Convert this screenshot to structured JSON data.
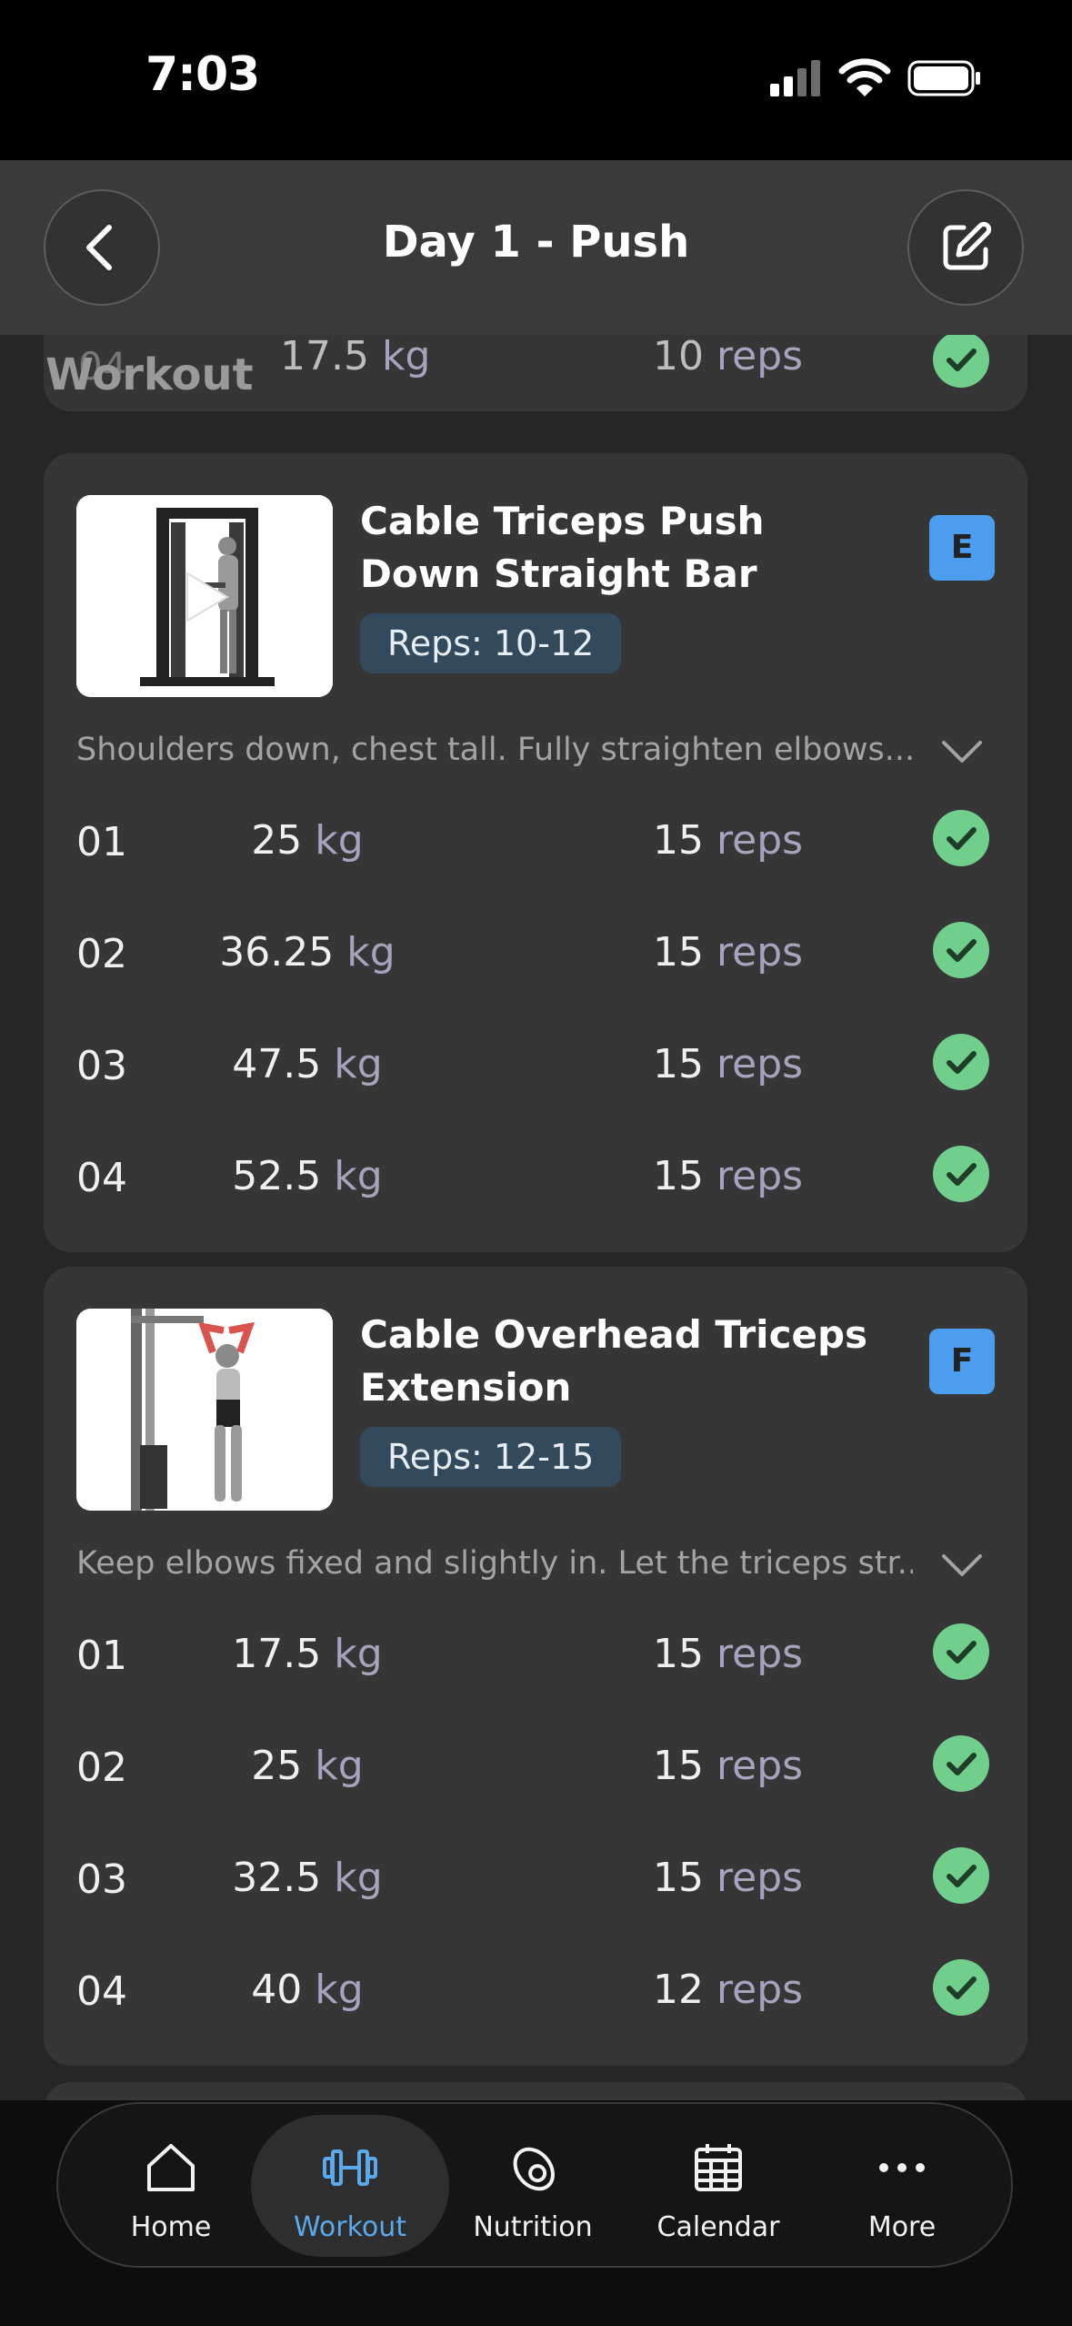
{
  "status": {
    "time": "7:03"
  },
  "header": {
    "title": "Day 1 - Push"
  },
  "overlay_label": "Workout",
  "previous_set": {
    "number": "04",
    "weight": "17.5",
    "unit_kg": "kg",
    "reps": "10",
    "unit_reps": "reps"
  },
  "exercises": [
    {
      "title": "Cable Triceps Push Down Straight Bar",
      "reps_target": "Reps: 10-12",
      "badge": "E",
      "note": "Shoulders down, chest tall. Fully straighten elbows...",
      "sets": [
        {
          "number": "01",
          "weight": "25",
          "reps": "15"
        },
        {
          "number": "02",
          "weight": "36.25",
          "reps": "15"
        },
        {
          "number": "03",
          "weight": "47.5",
          "reps": "15"
        },
        {
          "number": "04",
          "weight": "52.5",
          "reps": "15"
        }
      ]
    },
    {
      "title": "Cable Overhead Triceps Extension",
      "reps_target": "Reps: 12-15",
      "badge": "F",
      "note": "Keep elbows fixed and slightly in. Let the triceps str...",
      "sets": [
        {
          "number": "01",
          "weight": "17.5",
          "reps": "15"
        },
        {
          "number": "02",
          "weight": "25",
          "reps": "15"
        },
        {
          "number": "03",
          "weight": "32.5",
          "reps": "15"
        },
        {
          "number": "04",
          "weight": "40",
          "reps": "12"
        }
      ]
    }
  ],
  "units": {
    "kg": "kg",
    "reps": "reps"
  },
  "tabs": [
    {
      "label": "Home",
      "icon": "home-icon"
    },
    {
      "label": "Workout",
      "icon": "dumbbell-icon",
      "active": true
    },
    {
      "label": "Nutrition",
      "icon": "avocado-icon"
    },
    {
      "label": "Calendar",
      "icon": "calendar-icon"
    },
    {
      "label": "More",
      "icon": "more-icon"
    }
  ],
  "colors": {
    "accent": "#5aa9ec",
    "check": "#6fcf8b",
    "badge": "#4b9df0",
    "card": "#363636",
    "background": "#262626"
  }
}
